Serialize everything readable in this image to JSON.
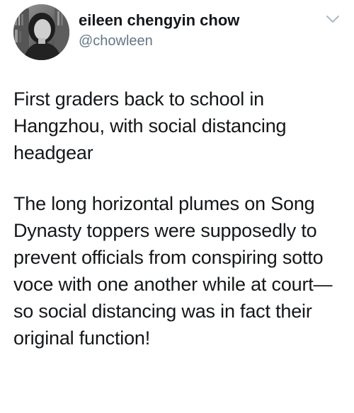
{
  "author": {
    "display_name": "eileen chengyin chow",
    "handle": "@chowleen"
  },
  "icons": {
    "avatar": "profile-photo",
    "menu": "chevron-down-icon"
  },
  "colors": {
    "text": "#14171a",
    "secondary_text": "#657786",
    "chevron": "#aab8c2",
    "background": "#ffffff"
  },
  "tweet": {
    "paragraphs": [
      "First graders back to school in Hangzhou, with social distancing headgear",
      "The long horizontal plumes on Song Dynasty toppers were supposedly to prevent officials from conspiring sotto voce with one another while at court—so social distancing was in fact their original function!"
    ]
  }
}
